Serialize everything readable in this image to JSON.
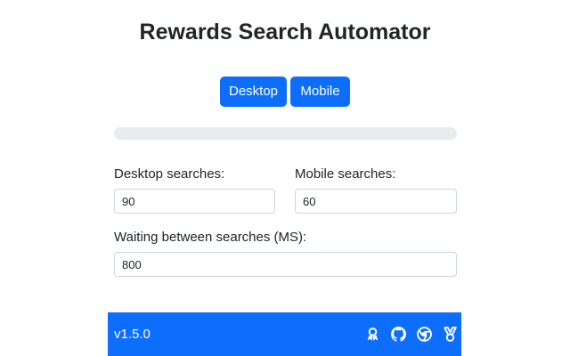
{
  "header": {
    "title": "Rewards Search Automator"
  },
  "mode_buttons": {
    "desktop_label": "Desktop",
    "mobile_label": "Mobile"
  },
  "progress": {
    "value": 0
  },
  "settings": {
    "desktop_searches_label": "Desktop searches:",
    "desktop_searches_value": "90",
    "mobile_searches_label": "Mobile searches:",
    "mobile_searches_value": "60",
    "wait_label": "Waiting between searches (MS):",
    "wait_value": "800"
  },
  "footer": {
    "version": "v1.5.0",
    "icons": [
      "rewards-badge-icon",
      "github-icon",
      "chrome-icon",
      "medal-icon"
    ]
  },
  "colors": {
    "accent": "#0d6efd",
    "progress_track": "#e9ecef",
    "text": "#212529",
    "footer_text": "#ffffff"
  }
}
